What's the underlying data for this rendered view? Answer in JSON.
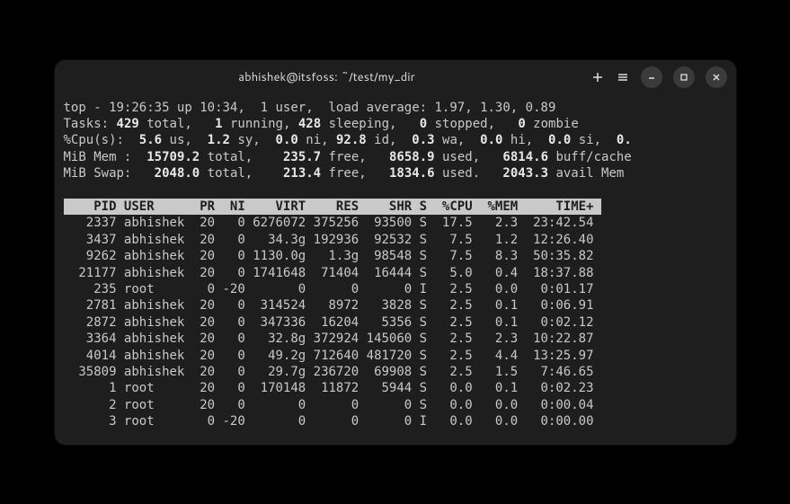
{
  "window": {
    "title": "abhishek@itsfoss: ~/test/my_dir"
  },
  "top": {
    "time": "19:26:35",
    "uptime": "10:34",
    "users": "1",
    "load1": "1.97",
    "load2": "1.30",
    "load3": "0.89"
  },
  "tasks": {
    "total": "429",
    "running": "1",
    "sleeping": "428",
    "stopped": "0",
    "zombie": "0"
  },
  "cpu": {
    "us": "5.6",
    "sy": "1.2",
    "ni": "0.0",
    "id": "92.8",
    "wa": "0.3",
    "hi": "0.0",
    "si": "0.0",
    "st": "0."
  },
  "mem": {
    "total": "15709.2",
    "free": "235.7",
    "used": "8658.9",
    "buff": "6814.6"
  },
  "swap": {
    "total": "2048.0",
    "free": "213.4",
    "used": "1834.6",
    "avail": "2043.3"
  },
  "headers": {
    "pid": "PID",
    "user": "USER",
    "pr": "PR",
    "ni": "NI",
    "virt": "VIRT",
    "res": "RES",
    "shr": "SHR",
    "s": "S",
    "cpu": "%CPU",
    "mem": "%MEM",
    "time": "TIME+"
  },
  "processes": [
    {
      "pid": "2337",
      "user": "abhishek",
      "pr": "20",
      "ni": "0",
      "virt": "6276072",
      "res": "375256",
      "shr": "93500",
      "s": "S",
      "cpu": "17.5",
      "mem": "2.3",
      "time": "23:42.54"
    },
    {
      "pid": "3437",
      "user": "abhishek",
      "pr": "20",
      "ni": "0",
      "virt": "34.3g",
      "res": "192936",
      "shr": "92532",
      "s": "S",
      "cpu": "7.5",
      "mem": "1.2",
      "time": "12:26.40"
    },
    {
      "pid": "9262",
      "user": "abhishek",
      "pr": "20",
      "ni": "0",
      "virt": "1130.0g",
      "res": "1.3g",
      "shr": "98548",
      "s": "S",
      "cpu": "7.5",
      "mem": "8.3",
      "time": "50:35.82"
    },
    {
      "pid": "21177",
      "user": "abhishek",
      "pr": "20",
      "ni": "0",
      "virt": "1741648",
      "res": "71404",
      "shr": "16444",
      "s": "S",
      "cpu": "5.0",
      "mem": "0.4",
      "time": "18:37.88"
    },
    {
      "pid": "235",
      "user": "root",
      "pr": "0",
      "ni": "-20",
      "virt": "0",
      "res": "0",
      "shr": "0",
      "s": "I",
      "cpu": "2.5",
      "mem": "0.0",
      "time": "0:01.17"
    },
    {
      "pid": "2781",
      "user": "abhishek",
      "pr": "20",
      "ni": "0",
      "virt": "314524",
      "res": "8972",
      "shr": "3828",
      "s": "S",
      "cpu": "2.5",
      "mem": "0.1",
      "time": "0:06.91"
    },
    {
      "pid": "2872",
      "user": "abhishek",
      "pr": "20",
      "ni": "0",
      "virt": "347336",
      "res": "16204",
      "shr": "5356",
      "s": "S",
      "cpu": "2.5",
      "mem": "0.1",
      "time": "0:02.12"
    },
    {
      "pid": "3364",
      "user": "abhishek",
      "pr": "20",
      "ni": "0",
      "virt": "32.8g",
      "res": "372924",
      "shr": "145060",
      "s": "S",
      "cpu": "2.5",
      "mem": "2.3",
      "time": "10:22.87"
    },
    {
      "pid": "4014",
      "user": "abhishek",
      "pr": "20",
      "ni": "0",
      "virt": "49.2g",
      "res": "712640",
      "shr": "481720",
      "s": "S",
      "cpu": "2.5",
      "mem": "4.4",
      "time": "13:25.97"
    },
    {
      "pid": "35809",
      "user": "abhishek",
      "pr": "20",
      "ni": "0",
      "virt": "29.7g",
      "res": "236720",
      "shr": "69908",
      "s": "S",
      "cpu": "2.5",
      "mem": "1.5",
      "time": "7:46.65"
    },
    {
      "pid": "1",
      "user": "root",
      "pr": "20",
      "ni": "0",
      "virt": "170148",
      "res": "11872",
      "shr": "5944",
      "s": "S",
      "cpu": "0.0",
      "mem": "0.1",
      "time": "0:02.23"
    },
    {
      "pid": "2",
      "user": "root",
      "pr": "20",
      "ni": "0",
      "virt": "0",
      "res": "0",
      "shr": "0",
      "s": "S",
      "cpu": "0.0",
      "mem": "0.0",
      "time": "0:00.04"
    },
    {
      "pid": "3",
      "user": "root",
      "pr": "0",
      "ni": "-20",
      "virt": "0",
      "res": "0",
      "shr": "0",
      "s": "I",
      "cpu": "0.0",
      "mem": "0.0",
      "time": "0:00.00"
    }
  ]
}
